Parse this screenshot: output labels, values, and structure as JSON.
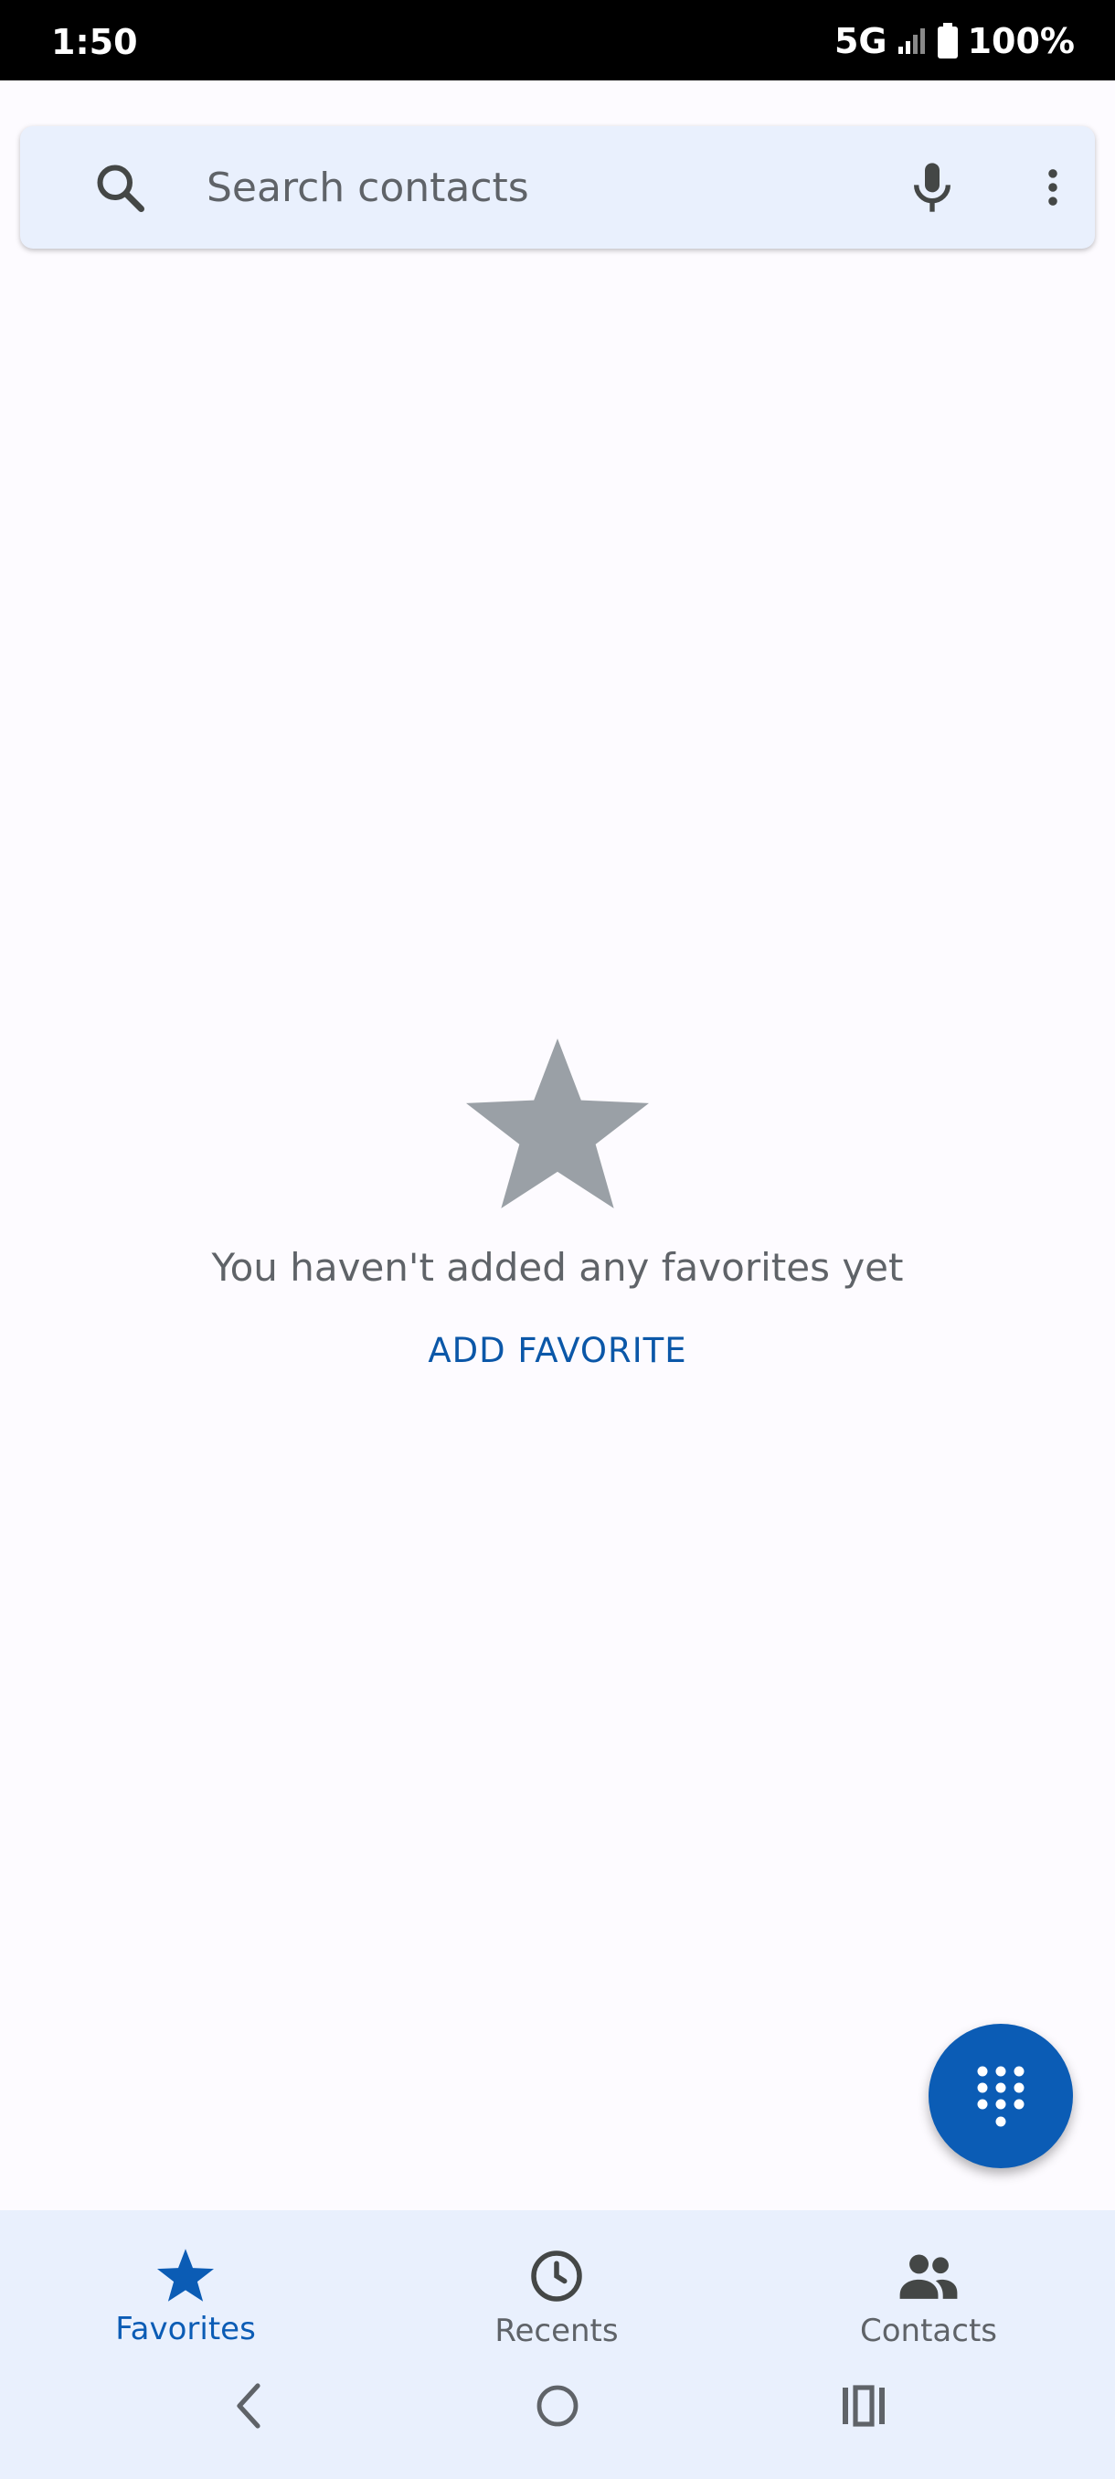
{
  "status_bar": {
    "time": "1:50",
    "network": "5G",
    "battery": "100%"
  },
  "search": {
    "placeholder": "Search contacts"
  },
  "empty_state": {
    "message": "You haven't added any favorites yet",
    "action_label": "ADD FAVORITE"
  },
  "bottom_nav": {
    "items": [
      {
        "label": "Favorites",
        "icon": "star-icon",
        "active": true
      },
      {
        "label": "Recents",
        "icon": "clock-icon",
        "active": false
      },
      {
        "label": "Contacts",
        "icon": "people-icon",
        "active": false
      }
    ]
  },
  "colors": {
    "accent": "#0b5cb5",
    "surface": "#e9f0fd",
    "background": "#fdfbff",
    "muted_text": "#5f6368",
    "star_gray": "#9aa0a6"
  }
}
